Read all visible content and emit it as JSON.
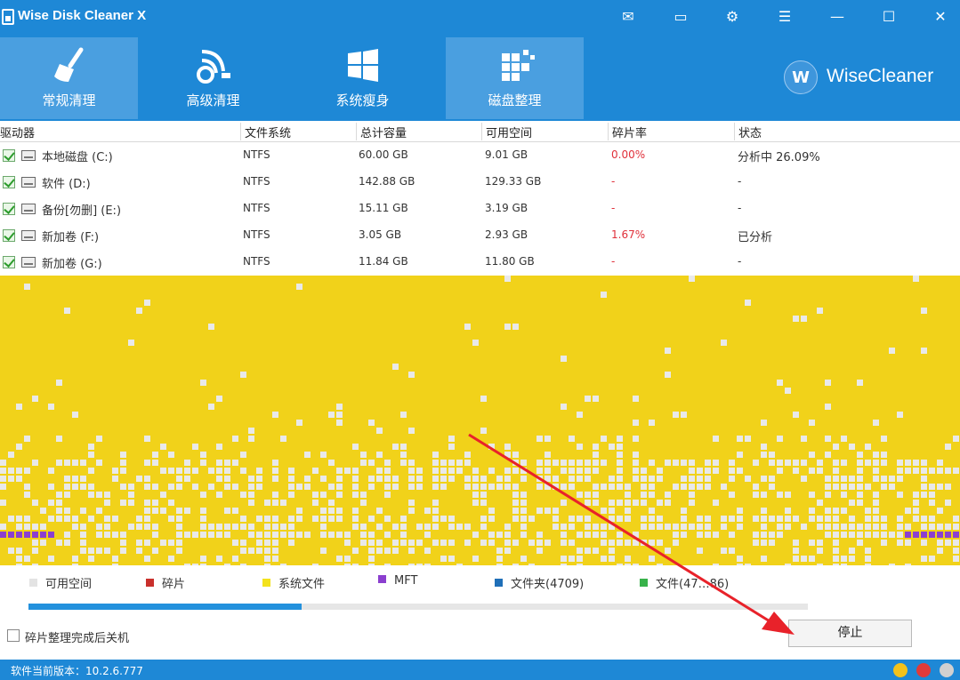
{
  "window": {
    "title": "Wise Disk Cleaner X",
    "controls": [
      "✉",
      "▭",
      "⚙",
      "☰",
      "—",
      "☐",
      "✕"
    ]
  },
  "nav": {
    "tabs": [
      {
        "label": "常规清理",
        "icon": "broom-icon",
        "active": true
      },
      {
        "label": "高级清理",
        "icon": "advanced-clean-icon",
        "active": false
      },
      {
        "label": "系统瘦身",
        "icon": "windows-logo-icon",
        "active": false
      },
      {
        "label": "磁盘整理",
        "icon": "defrag-blocks-icon",
        "active": true
      }
    ],
    "brand_logo": "W",
    "brand": "WiseCleaner"
  },
  "table": {
    "headers": [
      "驱动器",
      "文件系统",
      "总计容量",
      "可用空间",
      "碎片率",
      "状态"
    ],
    "rows": [
      {
        "name": "本地磁盘 (C:)",
        "fs": "NTFS",
        "total": "60.00 GB",
        "free": "9.01 GB",
        "frag": "0.00%",
        "frag_red": true,
        "status": "分析中 26.09%"
      },
      {
        "name": "软件 (D:)",
        "fs": "NTFS",
        "total": "142.88 GB",
        "free": "129.33 GB",
        "frag": "-",
        "frag_red": true,
        "status": "-"
      },
      {
        "name": "备份[勿删] (E:)",
        "fs": "NTFS",
        "total": "15.11 GB",
        "free": "3.19 GB",
        "frag": "-",
        "frag_red": true,
        "status": "-"
      },
      {
        "name": "新加卷 (F:)",
        "fs": "NTFS",
        "total": "3.05 GB",
        "free": "2.93 GB",
        "frag": "1.67%",
        "frag_red": true,
        "status": "已分析"
      },
      {
        "name": "新加卷 (G:)",
        "fs": "NTFS",
        "total": "11.84 GB",
        "free": "11.80 GB",
        "frag": "-",
        "frag_red": true,
        "status": "-"
      }
    ]
  },
  "legend": [
    {
      "label": "可用空间",
      "color": "#e3e3e3"
    },
    {
      "label": "碎片",
      "color": "#c9302c"
    },
    {
      "label": "系统文件",
      "color": "#f3e21c"
    },
    {
      "label": "MFT",
      "color": "#8b3fcf"
    },
    {
      "label": "文件夹(4709)",
      "color": "#1f6fb8"
    },
    {
      "label": "文件(47…86)",
      "color": "#38b24a"
    }
  ],
  "colors": {
    "accent": "#1e88d6",
    "cluster_used": "#f1d21a",
    "cluster_free": "#e9e9e9",
    "cluster_mft": "#8b3fcf",
    "annotation_arrow": "#e8222a"
  },
  "progress": {
    "fraction": 0.35
  },
  "shutdown_option": {
    "label": "碎片整理完成后关机",
    "checked": false
  },
  "stop_button": {
    "label": "停止"
  },
  "status_bar": {
    "version": "软件当前版本：10.2.6.777"
  }
}
